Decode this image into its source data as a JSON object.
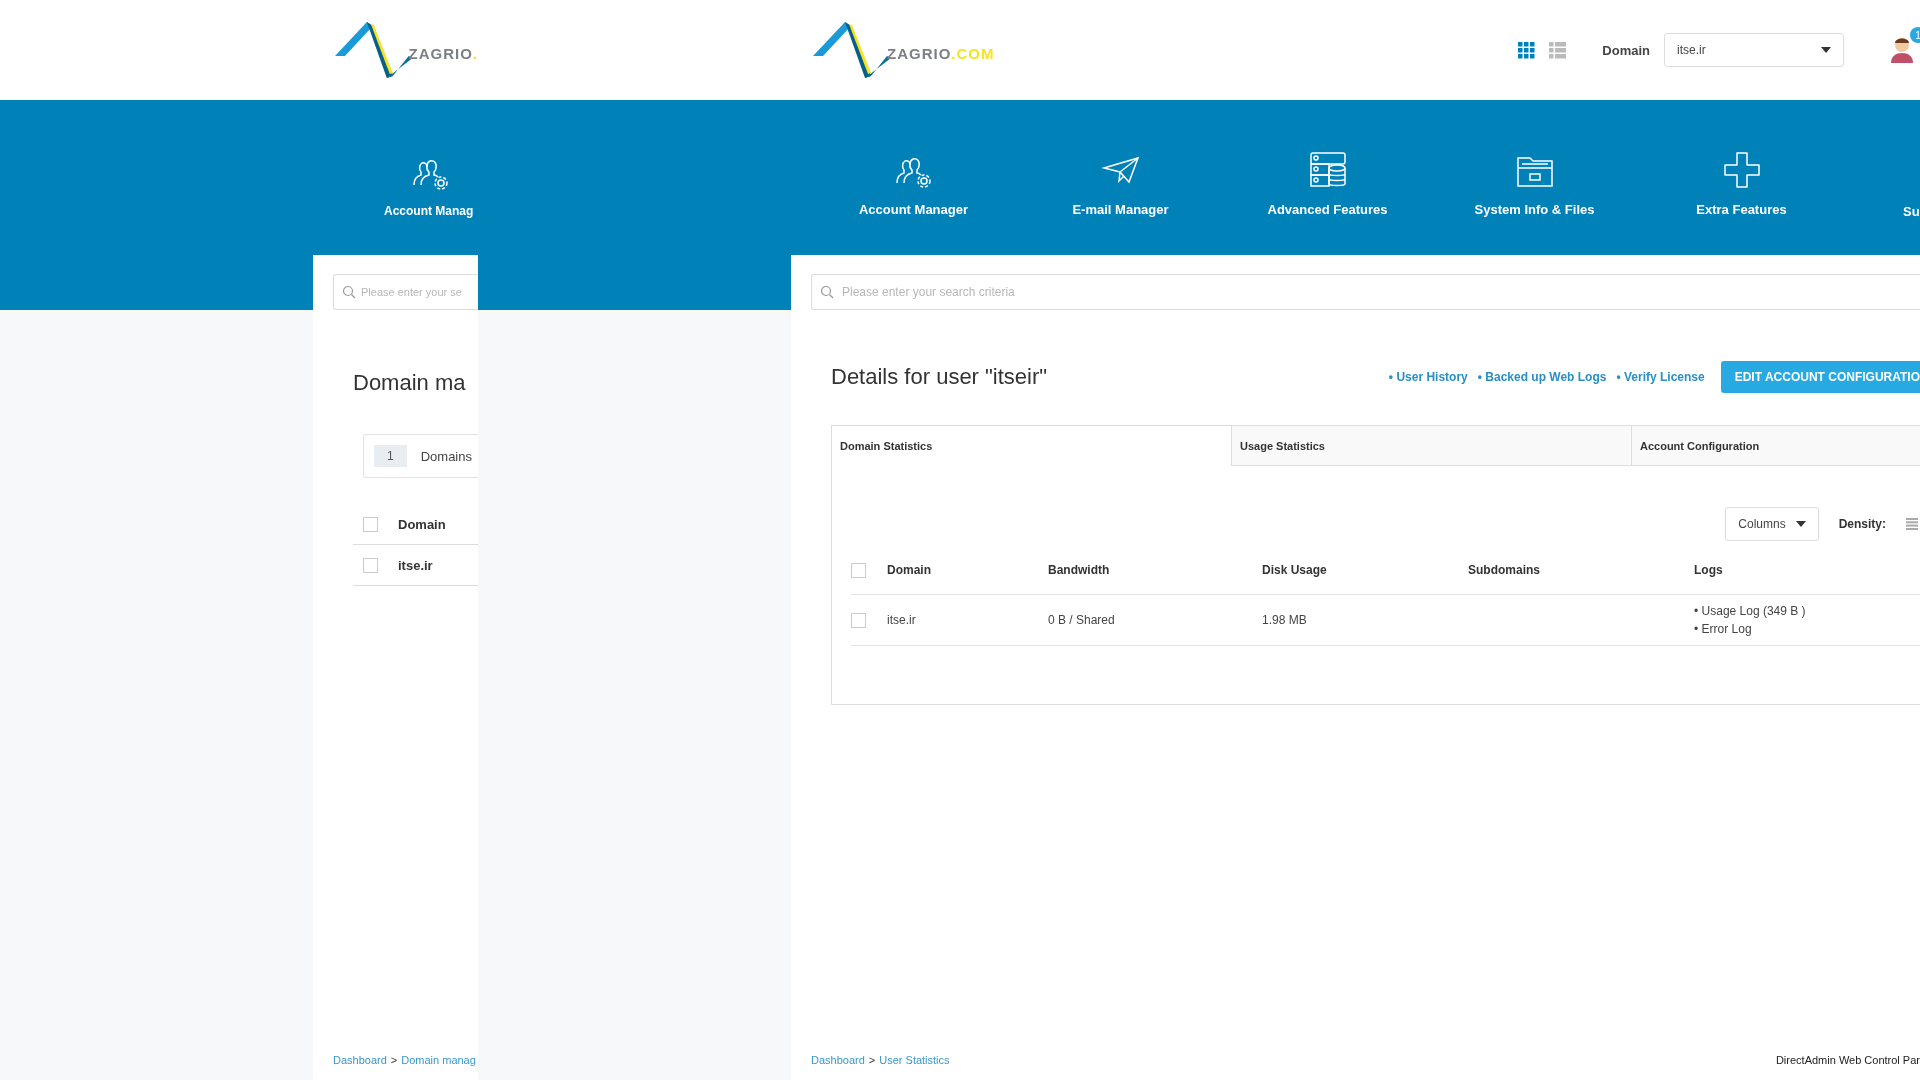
{
  "left_fragment": {
    "logo": {
      "name": "ZAGRIO",
      "suffix": "."
    },
    "nav": [
      {
        "label": "Account Manag",
        "kind": "users-gear"
      }
    ],
    "search": {
      "placeholder": "Please enter your se"
    },
    "heading": "Domain ma",
    "count": {
      "value": "1",
      "label": "Domains"
    },
    "table": {
      "header_checked": false,
      "columns": [
        "Domain"
      ],
      "rows": [
        {
          "selected": false,
          "domain": "itse.ir"
        }
      ]
    },
    "breadcrumb": {
      "items": [
        "Dashboard",
        "Domain manag"
      ],
      "separator": ">"
    }
  },
  "header": {
    "logo": {
      "name": "ZAGRIO",
      "suffix": ".COM"
    },
    "view_toggles": [
      {
        "kind": "grid",
        "selected": true
      },
      {
        "kind": "list",
        "selected": false
      }
    ],
    "domain_label": "Domain",
    "domain_select": {
      "value": "itse.ir"
    },
    "notification_count": "1"
  },
  "nav": [
    {
      "label": "Account Manager",
      "kind": "users-gear"
    },
    {
      "label": "E-mail Manager",
      "kind": "plane"
    },
    {
      "label": "Advanced Features",
      "kind": "server"
    },
    {
      "label": "System Info & Files",
      "kind": "folder"
    },
    {
      "label": "Extra Features",
      "kind": "plus"
    },
    {
      "label": "Su",
      "kind": "clipped"
    }
  ],
  "search": {
    "placeholder": "Please enter your search criteria"
  },
  "heading": "Details for user \"itseir\"",
  "links": [
    "• User History",
    "• Backed up Web Logs",
    "• Verify License"
  ],
  "edit_button": "EDIT ACCOUNT CONFIGURATIO",
  "tabs": [
    {
      "label": "Domain Statistics",
      "selected": true
    },
    {
      "label": "Usage Statistics",
      "selected": false
    },
    {
      "label": "Account Configuration",
      "selected": false
    }
  ],
  "columns_button": "Columns",
  "density_label": "Density:",
  "table": {
    "header_checked": false,
    "columns": [
      "Domain",
      "Bandwidth",
      "Disk Usage",
      "Subdomains",
      "Logs"
    ],
    "rows": [
      {
        "selected": false,
        "domain": "itse.ir",
        "bandwidth": "0 B / Shared",
        "disk_usage": "1.98 MB",
        "logs": [
          "• Usage Log (349 B )",
          "• Error Log"
        ]
      }
    ]
  },
  "breadcrumb": {
    "items": [
      "Dashboard",
      "User Statistics"
    ],
    "separator": ">"
  },
  "footer_text": "DirectAdmin Web Control Par"
}
